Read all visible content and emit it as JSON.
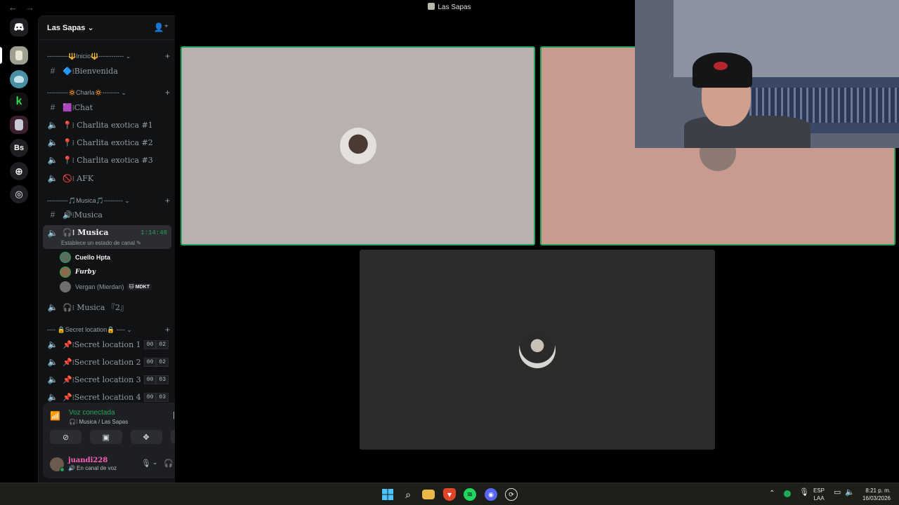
{
  "titlebar": {
    "title": "Las Sapas",
    "back_icon": "arrow-left-icon",
    "forward_icon": "arrow-right-icon"
  },
  "server_rail": {
    "items": [
      {
        "name": "discord-home",
        "icon": "discord-logo-icon",
        "color": "#313338"
      },
      {
        "name": "server-las-sapas",
        "color": "#9e9f8f"
      },
      {
        "name": "server-cat",
        "color": "#4a8fa3"
      },
      {
        "name": "server-k",
        "color": "#111111"
      },
      {
        "name": "server-anime",
        "color": "#3b1f2f"
      },
      {
        "name": "server-bs",
        "label": "Bs",
        "color": "#1e1f22"
      },
      {
        "name": "add-server",
        "icon": "plus-circle-icon"
      },
      {
        "name": "discover",
        "icon": "compass-icon"
      }
    ]
  },
  "server": {
    "name": "Las Sapas",
    "dropdown_icon": "chevron-down-icon",
    "invite_icon": "add-member-icon"
  },
  "categories": [
    {
      "label": "----------🔱Inicio🔱------------ ⌄"
    },
    {
      "label": "----------🔅Charla🔅-------- ⌄"
    },
    {
      "label": "----------🎵Musica🎵--------- ⌄"
    },
    {
      "label": "---- 🔒Secret location🔒 ---- ⌄"
    }
  ],
  "channels": [
    {
      "type": "text",
      "name": "🔷⁞Bienvenida"
    },
    {
      "type": "text",
      "name": "🟪⁞Chat"
    },
    {
      "type": "voice",
      "name": "📍⁞ Charlita exotica #1"
    },
    {
      "type": "voice",
      "name": "📍⁞ Charlita exotica #2"
    },
    {
      "type": "voice",
      "name": "📍⁞ Charlita exotica #3"
    },
    {
      "type": "voice",
      "name": "🚫⁞ AFK"
    },
    {
      "type": "text",
      "name": "🔊⁞Musica"
    },
    {
      "type": "voice",
      "name": "🎧⁞ Musica",
      "timer": "1:14:48",
      "status": "Establece un estado de canal ✎"
    },
    {
      "type": "voice",
      "name": "🎧⁞ Musica 『2』"
    },
    {
      "type": "voice",
      "name": "📌⁞Secret location 1",
      "count_a": "00",
      "count_b": "02"
    },
    {
      "type": "voice",
      "name": "📌⁞Secret location 2",
      "count_a": "00",
      "count_b": "02"
    },
    {
      "type": "voice",
      "name": "📌⁞Secret location 3",
      "count_a": "00",
      "count_b": "03"
    },
    {
      "type": "voice",
      "name": "📌⁞Secret location 4",
      "count_a": "00",
      "count_b": "03"
    }
  ],
  "voice_users": [
    {
      "name": "Cuello Hpta"
    },
    {
      "name": "Furby"
    },
    {
      "name": "Vergan (Mierdan)",
      "tag": "🐱 MDKT"
    }
  ],
  "voice_panel": {
    "status": "Voz conectada",
    "location": "🎧⁞ Musica / Las Sapas",
    "buttons": [
      "camera-off-icon",
      "screen-share-icon",
      "activities-icon",
      "soundboard-icon"
    ]
  },
  "user": {
    "name": "juandi228",
    "status": "🔊 En canal de voz"
  },
  "taskbar": {
    "lang_top": "ESP",
    "lang_bottom": "LAA",
    "time": "8:21 p. m.",
    "date": "16/03/2026"
  },
  "colors": {
    "accent_green": "#23a55a",
    "tile_1": "#b9b1af",
    "tile_2": "#c99a8f",
    "tile_3": "#2b2d2b",
    "username": "#ff5fb7"
  }
}
